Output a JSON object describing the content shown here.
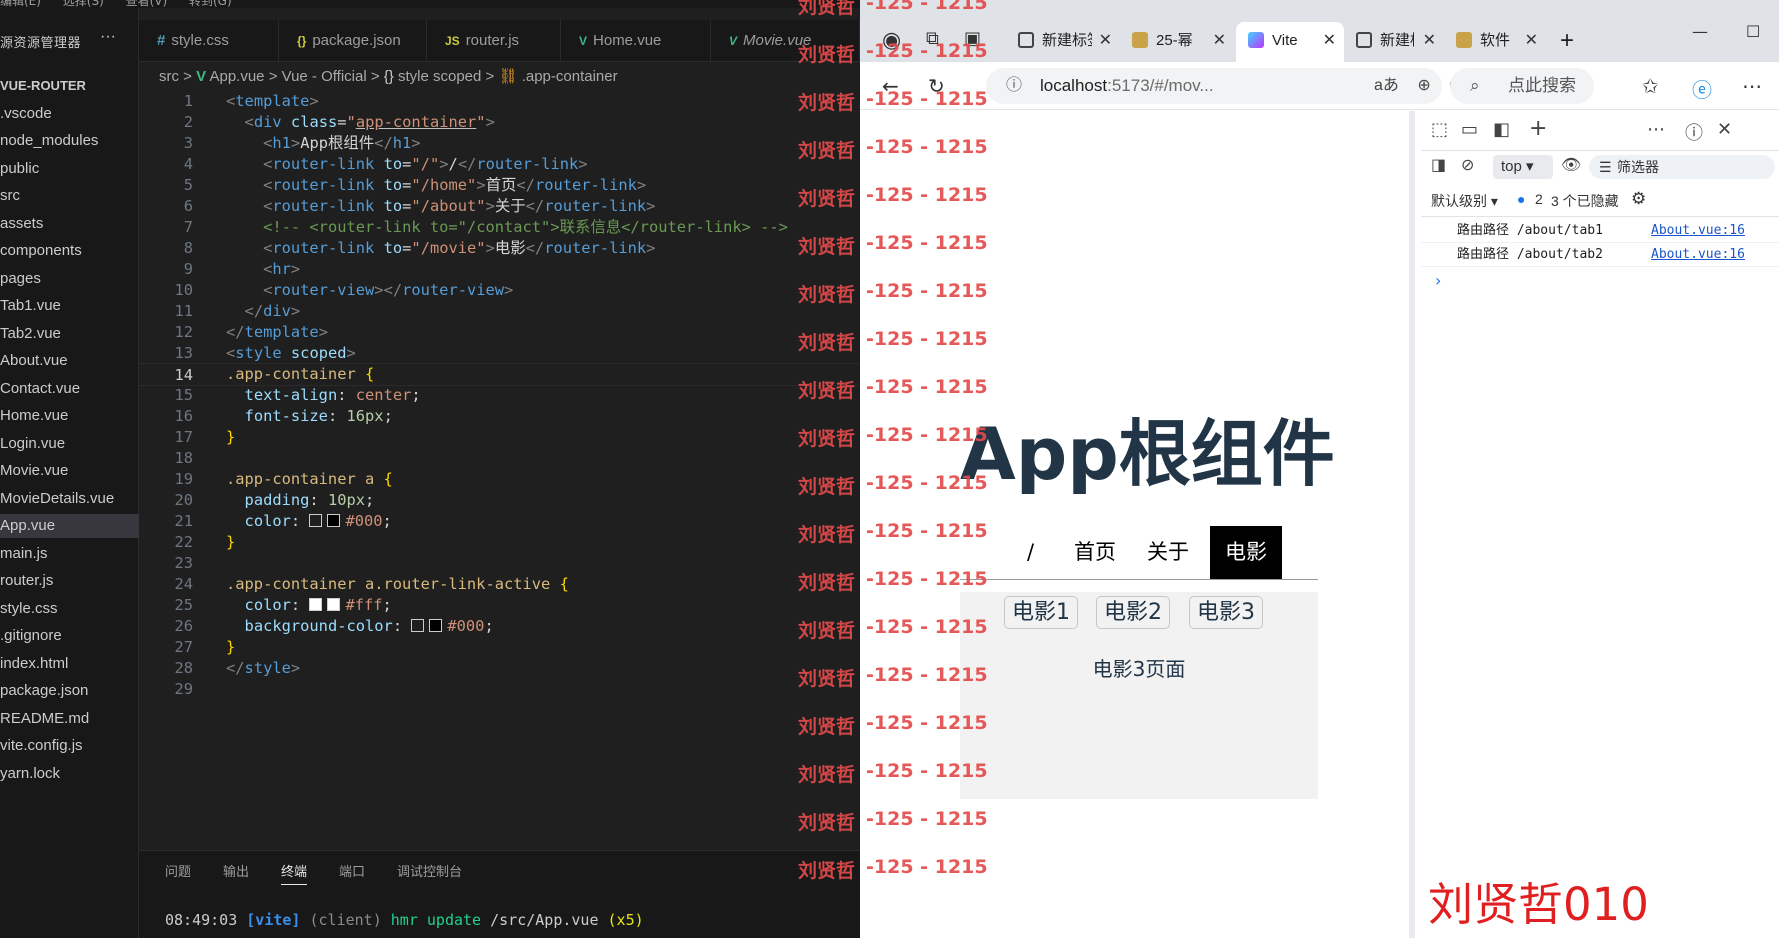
{
  "vscode": {
    "menubar": [
      "编辑(E)",
      "选择(S)",
      "查看(V)",
      "转到(G)"
    ],
    "explorer": {
      "title": "源资源管理器",
      "more": "···",
      "items": [
        {
          "label": "VUE-ROUTER",
          "bold": true
        },
        {
          "label": ".vscode"
        },
        {
          "label": "node_modules"
        },
        {
          "label": "public"
        },
        {
          "label": "src"
        },
        {
          "label": "assets"
        },
        {
          "label": "components"
        },
        {
          "label": "pages"
        },
        {
          "label": "Tab1.vue"
        },
        {
          "label": "Tab2.vue"
        },
        {
          "label": "About.vue"
        },
        {
          "label": "Contact.vue"
        },
        {
          "label": "Home.vue"
        },
        {
          "label": "Login.vue"
        },
        {
          "label": "Movie.vue"
        },
        {
          "label": "MovieDetails.vue"
        },
        {
          "label": "App.vue",
          "selected": true
        },
        {
          "label": "main.js"
        },
        {
          "label": "router.js"
        },
        {
          "label": "style.css"
        },
        {
          "label": ".gitignore"
        },
        {
          "label": "index.html"
        },
        {
          "label": "package.json"
        },
        {
          "label": "README.md"
        },
        {
          "label": "vite.config.js"
        },
        {
          "label": "yarn.lock"
        }
      ]
    },
    "tabs": [
      {
        "label": "style.css",
        "icon": "#"
      },
      {
        "label": "package.json",
        "icon": "{}"
      },
      {
        "label": "router.js",
        "icon": "JS"
      },
      {
        "label": "Home.vue",
        "icon": "V"
      },
      {
        "label": "Movie.vue",
        "icon": "V"
      }
    ],
    "breadcrumb": {
      "src": "src",
      "sep": ">",
      "file": "App.vue",
      "lang": "Vue - Official",
      "scope": "style scoped",
      "selector": ".app-container"
    },
    "line_numbers": [
      "1",
      "2",
      "3",
      "4",
      "5",
      "6",
      "7",
      "8",
      "9",
      "10",
      "11",
      "12",
      "13",
      "14",
      "15",
      "16",
      "17",
      "18",
      "19",
      "20",
      "21",
      "22",
      "23",
      "24",
      "25",
      "26",
      "27",
      "28",
      "29"
    ],
    "current_line": 14,
    "code": {
      "l1": "template",
      "l2_tag": "div",
      "l2_attr": "class",
      "l2_val": "app-container",
      "l3_tag": "h1",
      "l3_text": "App根组件",
      "l4_attr": "to",
      "l4_val": "/",
      "l4_text": "/",
      "l5_val": "/home",
      "l5_text": "首页",
      "l6_val": "/about",
      "l6_text": "关于",
      "l7": "<!-- <router-link to=\"/contact\">联系信息</router-link> -->",
      "l8_val": "/movie",
      "l8_text": "电影",
      "l9": "hr",
      "l10": "router-view",
      "router_link": "router-link",
      "l13_tag": "style",
      "l13_attr": "scoped",
      "l14_sel": ".app-container",
      "l15_prop": "text-align",
      "l15_val": "center",
      "l16_prop": "font-size",
      "l16_val": "16px",
      "l19_sel": ".app-container a",
      "l20_prop": "padding",
      "l20_val": "10px",
      "l21_prop": "color",
      "l21_val": "#000",
      "l24_sel": ".app-container a.router-link-active",
      "l25_prop": "color",
      "l25_val": "#fff",
      "l26_prop": "background-color",
      "l26_val": "#000"
    },
    "panel_tabs": [
      "问题",
      "输出",
      "终端",
      "端口",
      "调试控制台"
    ],
    "active_panel_tab": "终端",
    "terminal": {
      "time": "08:49:03",
      "vite": "[vite]",
      "client": "(client)",
      "hmr": "hmr update",
      "path": "/src/App.vue",
      "count": "(x5)"
    }
  },
  "browser": {
    "tabs": [
      {
        "label": "新建标签页"
      },
      {
        "label": "25-幂"
      },
      {
        "label": "Vite",
        "active": true
      },
      {
        "label": "新建标签页"
      },
      {
        "label": "软件"
      }
    ],
    "new_tab": "+",
    "url_host": "localhost",
    "url_rest": ":5173/#/mov...",
    "search_placeholder": "点此搜索",
    "page": {
      "title": "App根组件",
      "nav": [
        "/",
        "首页",
        "关于",
        "电影"
      ],
      "active_nav": "电影",
      "movie_buttons": [
        "电影1",
        "电影2",
        "电影3"
      ],
      "movie_page": "电影3页面"
    },
    "devtools": {
      "context": "top",
      "filter": "筛选器",
      "level": "默认级别",
      "issues_count": "2",
      "hidden": "3 个已隐藏",
      "logs": [
        {
          "msg": "路由路径 /about/tab1",
          "src": "About.vue:16"
        },
        {
          "msg": "路由路径 /about/tab2",
          "src": "About.vue:16"
        }
      ],
      "prompt": "›"
    }
  },
  "watermark": {
    "name": "刘贤哲",
    "numbers": "-125 - 1215",
    "footer": "刘贤哲010"
  },
  "colors": {
    "vue_green": "#41b883",
    "watermark_red": "#e34a4a",
    "page_title": "#213547"
  }
}
